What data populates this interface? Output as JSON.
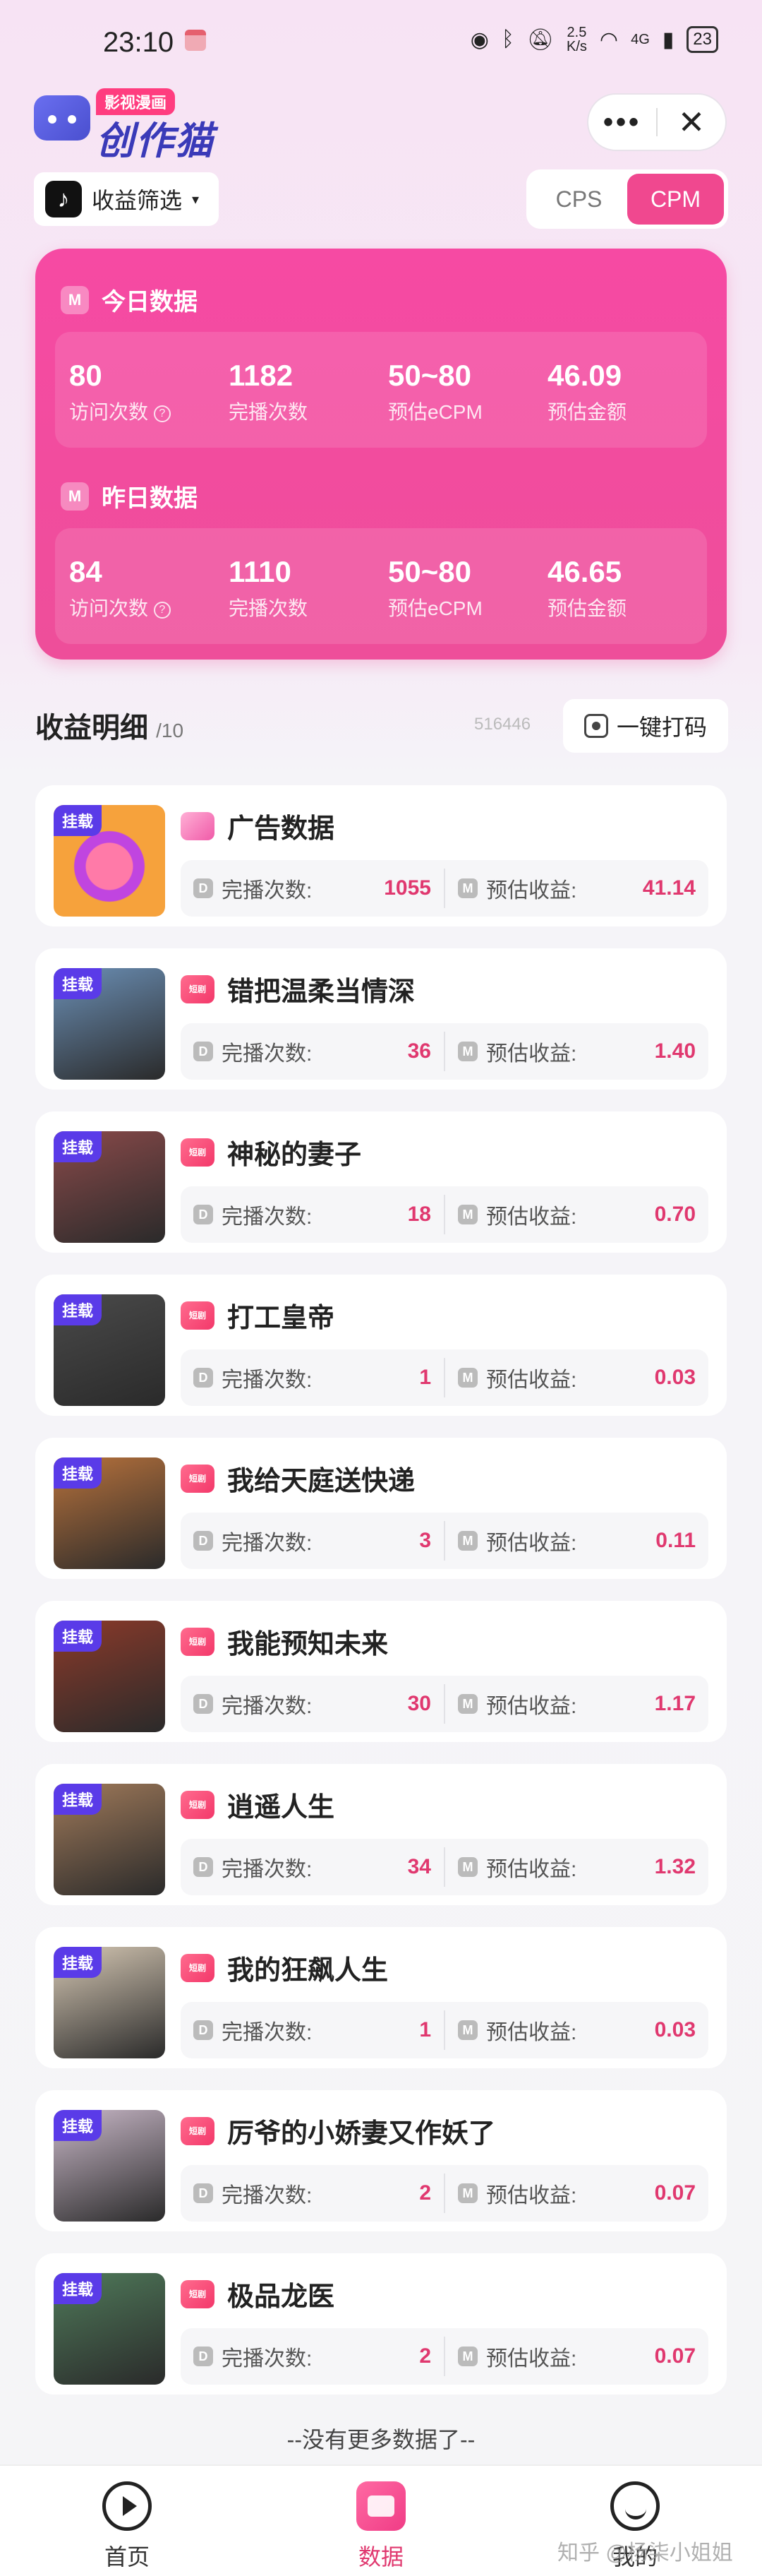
{
  "status_bar": {
    "time": "23:10",
    "net_speed_top": "2.5",
    "net_speed_bottom": "K/s",
    "signal": "4G",
    "battery": "23"
  },
  "header": {
    "logo_badge": "影视漫画",
    "logo_text": "创作猫",
    "more_label": "•••",
    "close_label": "✕"
  },
  "filter": {
    "label": "收益筛选",
    "caret": "▾",
    "tiktok_glyph": "♪"
  },
  "mode_toggle": {
    "options": [
      "CPS",
      "CPM"
    ],
    "active": "CPM"
  },
  "stats": {
    "today": {
      "title": "今日数据",
      "m_icon": "M",
      "items": [
        {
          "value": "80",
          "label": "访问次数"
        },
        {
          "value": "1182",
          "label": "完播次数"
        },
        {
          "value": "50~80",
          "label": "预估eCPM"
        },
        {
          "value": "46.09",
          "label": "预估金额"
        }
      ]
    },
    "yesterday": {
      "title": "昨日数据",
      "m_icon": "M",
      "items": [
        {
          "value": "84",
          "label": "访问次数"
        },
        {
          "value": "1110",
          "label": "完播次数"
        },
        {
          "value": "50~80",
          "label": "预估eCPM"
        },
        {
          "value": "46.65",
          "label": "预估金额"
        }
      ]
    },
    "help_glyph": "?"
  },
  "detail": {
    "title": "收益明细",
    "count": "/10",
    "user_id": "516446",
    "code_button": "一键打码"
  },
  "list_labels": {
    "tag": "挂载",
    "plays_label": "完播次数:",
    "income_label": "预估收益:",
    "plays_icon": "D",
    "income_icon": "M",
    "src_icon": "短剧"
  },
  "items": [
    {
      "title": "广告数据",
      "plays": "1055",
      "income": "41.14",
      "thumb_color": "#f6a23c",
      "ad": true
    },
    {
      "title": "错把温柔当情深",
      "plays": "36",
      "income": "1.40",
      "thumb_color": "#6b8fb5"
    },
    {
      "title": "神秘的妻子",
      "plays": "18",
      "income": "0.70",
      "thumb_color": "#8a4a4a"
    },
    {
      "title": "打工皇帝",
      "plays": "1",
      "income": "0.03",
      "thumb_color": "#4a4a4a"
    },
    {
      "title": "我给天庭送快递",
      "plays": "3",
      "income": "0.11",
      "thumb_color": "#b8723c"
    },
    {
      "title": "我能预知未来",
      "plays": "30",
      "income": "1.17",
      "thumb_color": "#8c3a2a"
    },
    {
      "title": "逍遥人生",
      "plays": "34",
      "income": "1.32",
      "thumb_color": "#a07a5a"
    },
    {
      "title": "我的狂飙人生",
      "plays": "1",
      "income": "0.03",
      "thumb_color": "#d6c8b4"
    },
    {
      "title": "厉爷的小娇妻又作妖了",
      "plays": "2",
      "income": "0.07",
      "thumb_color": "#c9b8c8"
    },
    {
      "title": "极品龙医",
      "plays": "2",
      "income": "0.07",
      "thumb_color": "#4f7a5a"
    }
  ],
  "no_more": "--没有更多数据了--",
  "nav": {
    "home": "首页",
    "data": "数据",
    "me": "我的",
    "active": "数据"
  },
  "watermark": "知乎 @杨柒小姐姐"
}
